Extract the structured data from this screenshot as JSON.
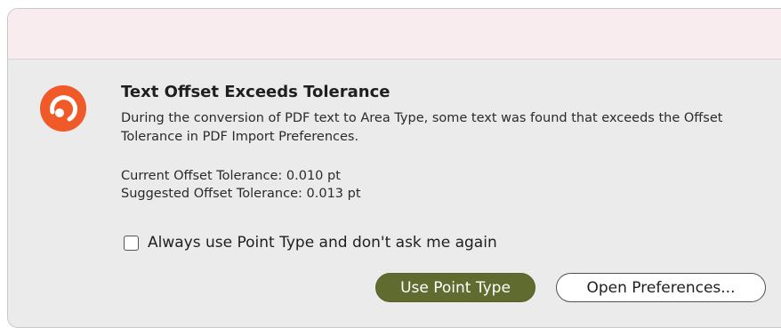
{
  "dialog": {
    "title": "Text Offset Exceeds Tolerance",
    "message": "During the conversion of PDF text to Area Type, some text was found that exceeds the Offset Tolerance in PDF Import Preferences.",
    "current_tolerance": "Current Offset Tolerance: 0.010 pt",
    "suggested_tolerance": "Suggested Offset Tolerance: 0.013 pt",
    "checkbox_label": "Always use Point Type and don't ask me again",
    "checkbox_checked": false,
    "icon": "app-logo-icon"
  },
  "buttons": {
    "primary_label": "Use Point Type",
    "secondary_label": "Open Preferences..."
  },
  "colors": {
    "icon_accent": "#f05a28",
    "primary_button": "#5f6b2f",
    "titlebar": "#f9ecee",
    "dialog_background": "#ebebeb"
  }
}
